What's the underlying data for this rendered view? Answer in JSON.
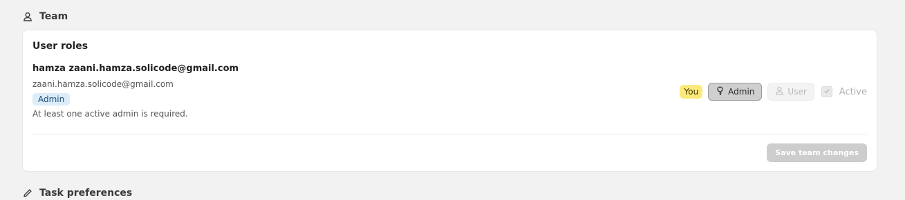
{
  "team_section": {
    "title": "Team",
    "icon": "user-icon"
  },
  "card": {
    "title": "User roles",
    "user": {
      "name": "hamza zaani.hamza.solicode@gmail.com",
      "email": "zaani.hamza.solicode@gmail.com",
      "role_badge": "Admin",
      "note": "At least one active admin is required."
    },
    "controls": {
      "you_badge": "You",
      "admin_button": "Admin",
      "user_button": "User",
      "active_label": "Active",
      "active_checked": true
    },
    "save_button": "Save team changes"
  },
  "task_section": {
    "title": "Task preferences",
    "icon": "pencil-icon"
  },
  "colors": {
    "page_bg": "#f2f2f2",
    "role_badge_bg": "#dcecf9",
    "you_badge_bg": "#fbe97a",
    "admin_selected_bg": "#cfcfcf",
    "save_disabled_bg": "#cdcdcd"
  }
}
